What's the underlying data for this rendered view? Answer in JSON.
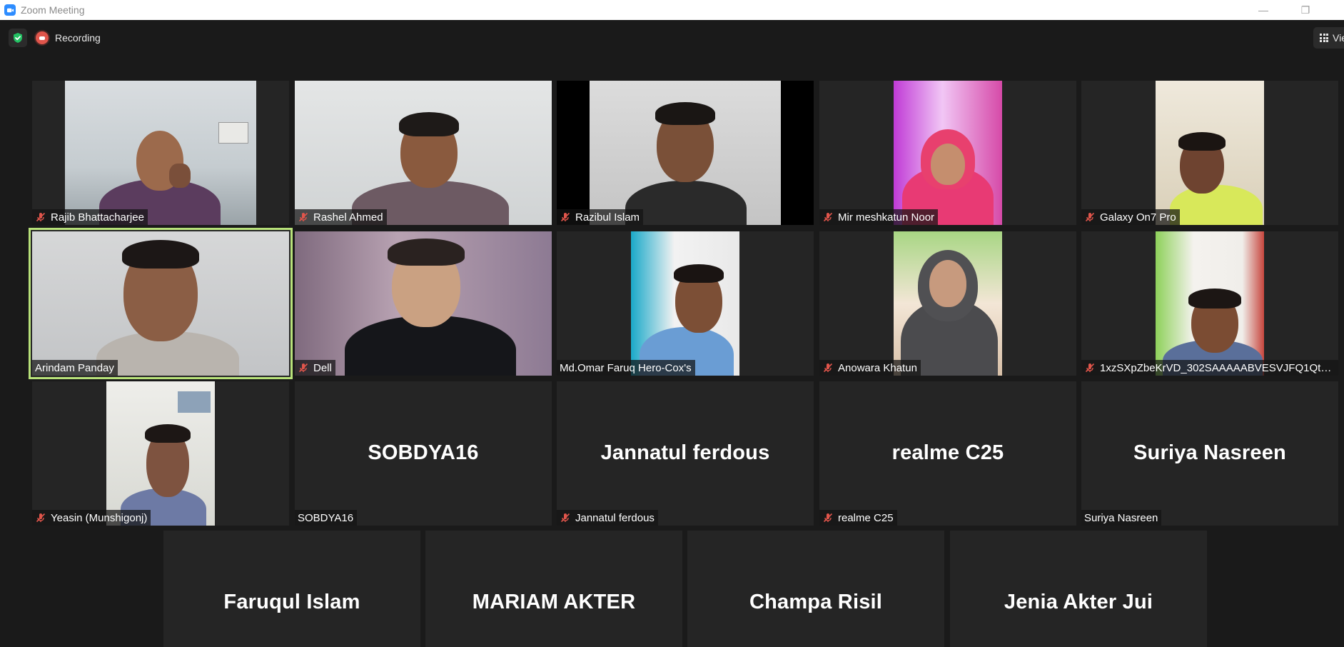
{
  "window": {
    "title": "Zoom Meeting",
    "minimize": "—",
    "maximize": "❐"
  },
  "toolbar": {
    "recording_label": "Recording",
    "view_label": "View"
  },
  "colors": {
    "speaking_border": "#b8e27a",
    "recording": "#e0554b",
    "encryption": "#23c063",
    "muted_mic": "#e0554b"
  },
  "participants": [
    {
      "name": "Rajib Bhattacharjee",
      "muted": true,
      "video": true
    },
    {
      "name": "Rashel Ahmed",
      "muted": true,
      "video": true
    },
    {
      "name": "Razibul Islam",
      "muted": true,
      "video": true
    },
    {
      "name": "Mir meshkatun Noor",
      "muted": true,
      "video": true
    },
    {
      "name": "Galaxy On7 Pro",
      "muted": true,
      "video": true
    },
    {
      "name": "Arindam Panday",
      "muted": false,
      "video": true,
      "speaking": true
    },
    {
      "name": "Dell",
      "muted": true,
      "video": true
    },
    {
      "name": "Md.Omar Faruq Hero-Cox's",
      "muted": false,
      "video": true
    },
    {
      "name": "Anowara Khatun",
      "muted": true,
      "video": true
    },
    {
      "name": "1xzSXpZbeKrVD_302SAAAAABVESVJFQ1QtT...",
      "muted": true,
      "video": true
    },
    {
      "name": "Yeasin (Munshigonj)",
      "muted": true,
      "video": true
    },
    {
      "name": "SOBDYA16",
      "muted": false,
      "video": false
    },
    {
      "name": "Jannatul ferdous",
      "muted": true,
      "video": false
    },
    {
      "name": "realme C25",
      "muted": true,
      "video": false
    },
    {
      "name": "Suriya Nasreen",
      "muted": false,
      "video": false
    },
    {
      "name": "Faruqul Islam",
      "muted": false,
      "video": false
    },
    {
      "name": "MARIAM AKTER",
      "muted": false,
      "video": false
    },
    {
      "name": "Champa Risil",
      "muted": false,
      "video": false
    },
    {
      "name": "Jenia Akter Jui",
      "muted": false,
      "video": false
    }
  ]
}
